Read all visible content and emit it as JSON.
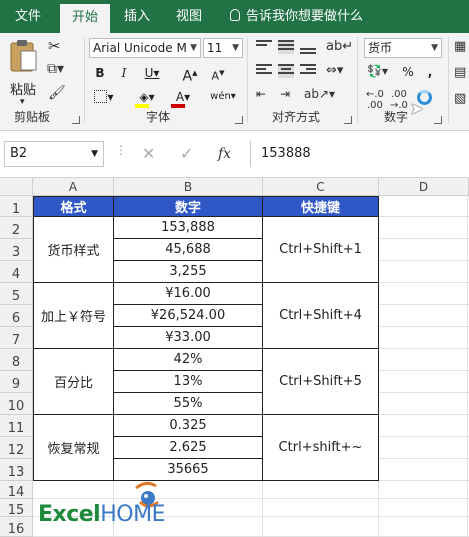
{
  "ribbon_tabs": [
    "文件",
    "开始",
    "插入",
    "视图"
  ],
  "active_tab": "开始",
  "tell_me": "告诉我你想要做什么",
  "clipboard": {
    "paste_label": "粘贴",
    "group_label": "剪贴板"
  },
  "font": {
    "name": "Arial Unicode M",
    "size": "11",
    "group_label": "字体",
    "bold": "B",
    "italic": "I",
    "underline": "U",
    "grow": "A",
    "shrink": "A",
    "color_letter": "A",
    "fill_color": "#ffff00",
    "font_color": "#d00000"
  },
  "alignment": {
    "group_label": "对齐方式"
  },
  "number": {
    "format": "货币",
    "percent": "%",
    "comma": ",",
    "group_label": "数字"
  },
  "formula_bar": {
    "name_box": "B2",
    "cancel": "✕",
    "enter": "✓",
    "fx": "fx",
    "value": "153888"
  },
  "columns": [
    "A",
    "B",
    "C",
    "D"
  ],
  "rows": [
    "1",
    "2",
    "3",
    "4",
    "5",
    "6",
    "7",
    "8",
    "9",
    "10",
    "11",
    "12",
    "13",
    "14",
    "15",
    "16"
  ],
  "table": {
    "headers": [
      "格式",
      "数字",
      "快捷键"
    ],
    "header_color": "#2f58c6",
    "groups": [
      {
        "format": "货币样式",
        "values": [
          "153,888",
          "45,688",
          "3,255"
        ],
        "shortcut": "Ctrl+Shift+1"
      },
      {
        "format": "加上￥符号",
        "values": [
          "¥16.00",
          "¥26,524.00",
          "¥33.00"
        ],
        "shortcut": "Ctrl+Shift+4"
      },
      {
        "format": "百分比",
        "values": [
          "42%",
          "13%",
          "55%"
        ],
        "shortcut": "Ctrl+Shift+5"
      },
      {
        "format": "恢复常规",
        "values": [
          "0.325",
          "2.625",
          "35665"
        ],
        "shortcut": "Ctrl+shift+~"
      }
    ]
  },
  "watermark": {
    "excel": "Excel",
    "home": "HOME"
  }
}
